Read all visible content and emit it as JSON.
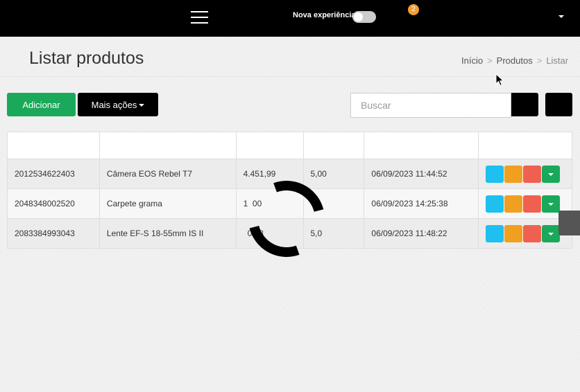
{
  "topbar": {
    "experience_label": "Nova experiência",
    "notification_count": "2",
    "experience_toggle_on": false
  },
  "page": {
    "title": "Listar produtos"
  },
  "breadcrumb": {
    "items": [
      "Início",
      "Produtos",
      "Listar"
    ],
    "separator": ">"
  },
  "toolbar": {
    "add_label": "Adicionar",
    "more_label": "Mais ações"
  },
  "search": {
    "placeholder": "Buscar"
  },
  "table": {
    "rows": [
      {
        "code": "2012534622403",
        "name": "Câmera EOS Rebel T7",
        "price": "4.451,99",
        "qty": "5,00",
        "date": "06/09/2023 11:44:52"
      },
      {
        "code": "2048348002520",
        "name": "Carpete grama",
        "price": "1  00",
        "qty": "",
        "date": "06/09/2023 14:25:38"
      },
      {
        "code": "2083384993043",
        "name": "Lente EF-S 18-55mm IS II",
        "price": "0,38",
        "qty": "5,0",
        "date": "06/09/2023 11:48:22"
      }
    ]
  },
  "colors": {
    "topbar": "#000000",
    "add_button": "#1aa85a",
    "view_action": "#1ec0f0",
    "edit_action": "#f0a020",
    "delete_action": "#f06050",
    "more_action": "#1aa85a",
    "badge": "#f0a030"
  }
}
